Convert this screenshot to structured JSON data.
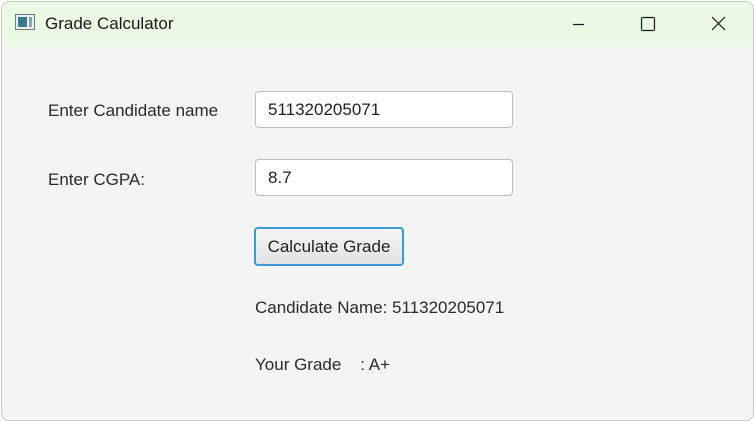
{
  "window": {
    "title": "Grade Calculator"
  },
  "form": {
    "name_label": "Enter Candidate name",
    "name_value": "511320205071",
    "cgpa_label": "Enter CGPA:",
    "cgpa_value": "8.7",
    "calculate_label": "Calculate Grade"
  },
  "results": {
    "candidate_name": "Candidate Name: 511320205071",
    "grade": "Your Grade    : A+"
  },
  "icons": {
    "app": "app-window-icon",
    "minimize": "minimize-icon",
    "maximize": "maximize-icon",
    "close": "close-icon"
  }
}
